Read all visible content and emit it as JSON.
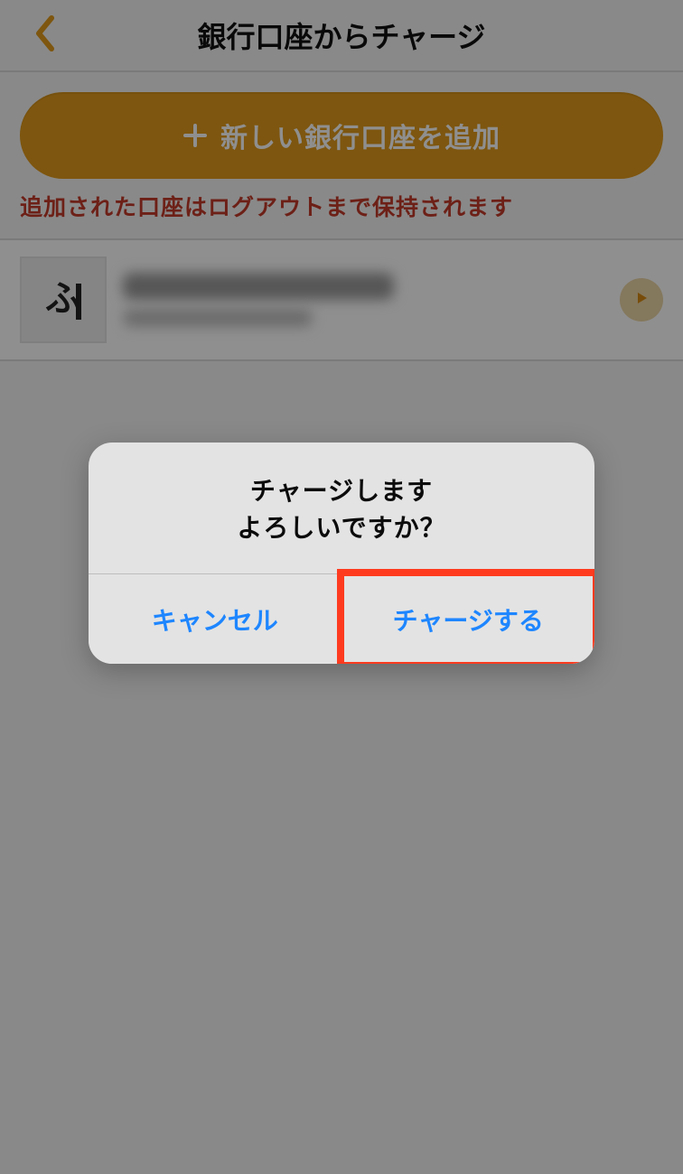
{
  "header": {
    "title": "銀行口座からチャージ"
  },
  "add_button": {
    "label": "新しい銀行口座を追加"
  },
  "notice": "追加された口座はログアウトまで保持されます",
  "dialog": {
    "line1": "チャージします",
    "line2": "よろしいですか？",
    "cancel_label": "キャンセル",
    "confirm_label": "チャージする"
  },
  "icons": {
    "back": "chevron-left-icon",
    "plus": "plus-icon",
    "play": "play-icon"
  },
  "colors": {
    "accent": "#e09a1b",
    "danger_text": "#c33a2a",
    "link": "#1e86ff",
    "highlight": "#ff3b1f"
  }
}
